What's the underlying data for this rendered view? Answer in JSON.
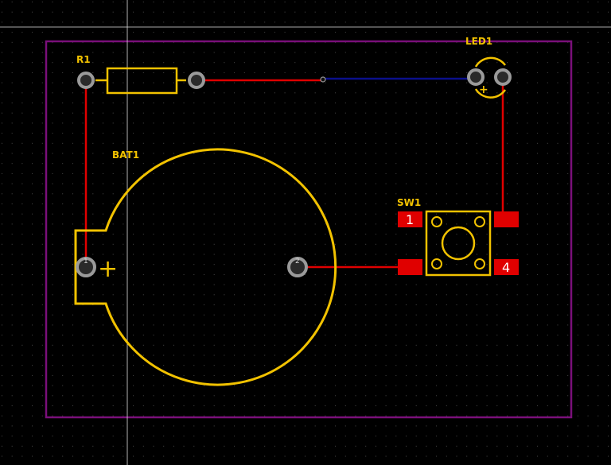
{
  "board": {
    "background": "#000000",
    "grid_color": "#4a4a4a",
    "cursor_color": "#e0e0e0",
    "edge_color": "#7a0f7a"
  },
  "colors": {
    "silkscreen": "#f2c200",
    "front_copper": "#e00000",
    "back_copper": "#0a0f8c",
    "pad_ring": "#9a9a9a",
    "pad_hole": "#2a2a2a"
  },
  "components": {
    "r1": {
      "ref": "R1"
    },
    "led1": {
      "ref": "LED1",
      "polarity": "+"
    },
    "bat1": {
      "ref": "BAT1",
      "polarity": "+",
      "pad1": "1",
      "pad2": "2"
    },
    "sw1": {
      "ref": "SW1",
      "pad1": "1",
      "pad4": "4"
    }
  }
}
